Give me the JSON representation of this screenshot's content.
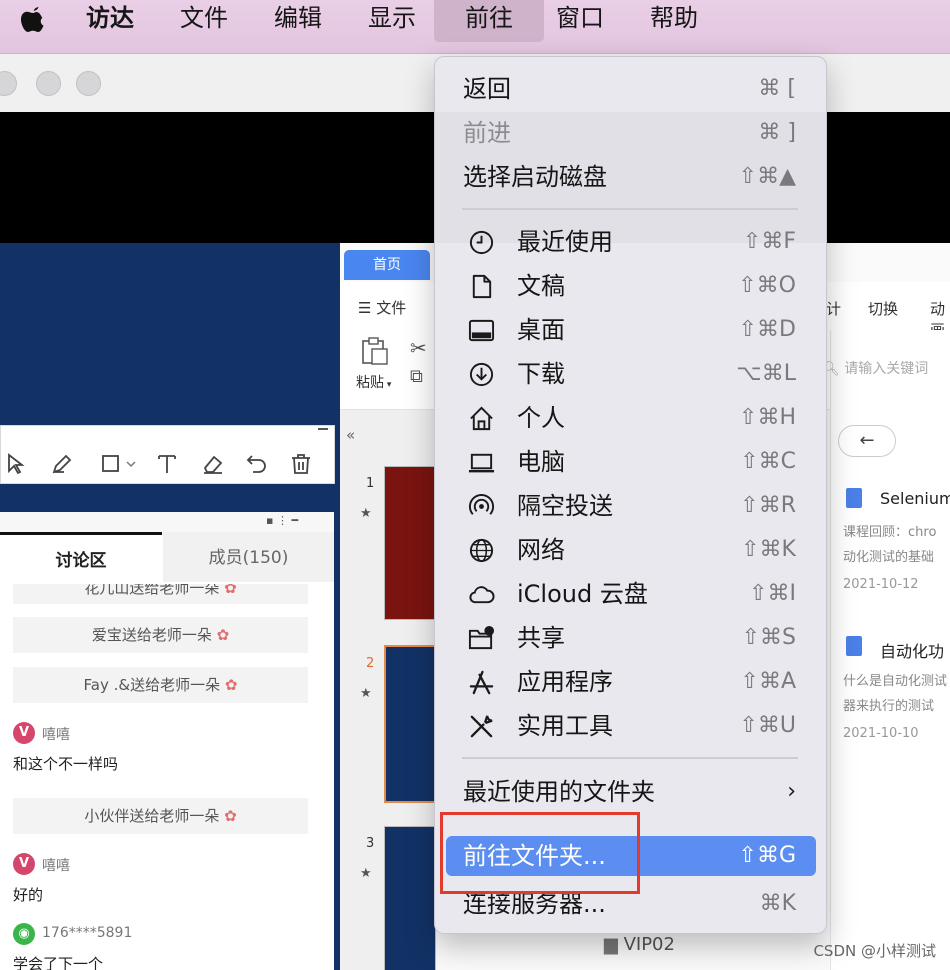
{
  "menubar": {
    "items": [
      "访达",
      "文件",
      "编辑",
      "显示",
      "前往",
      "窗口",
      "帮助"
    ],
    "active_index": 4
  },
  "go_menu": {
    "nav": [
      {
        "label": "返回",
        "shortcut": "⌘ [",
        "disabled": false
      },
      {
        "label": "前进",
        "shortcut": "⌘ ]",
        "disabled": true
      },
      {
        "label": "选择启动磁盘",
        "shortcut": "⇧⌘▲",
        "disabled": false
      }
    ],
    "places": [
      {
        "label": "最近使用",
        "shortcut": "⇧⌘F",
        "icon": "clock-icon"
      },
      {
        "label": "文稿",
        "shortcut": "⇧⌘O",
        "icon": "document-icon"
      },
      {
        "label": "桌面",
        "shortcut": "⇧⌘D",
        "icon": "desktop-icon"
      },
      {
        "label": "下载",
        "shortcut": "⌥⌘L",
        "icon": "download-icon"
      },
      {
        "label": "个人",
        "shortcut": "⇧⌘H",
        "icon": "home-icon"
      },
      {
        "label": "电脑",
        "shortcut": "⇧⌘C",
        "icon": "laptop-icon"
      },
      {
        "label": "隔空投送",
        "shortcut": "⇧⌘R",
        "icon": "airdrop-icon"
      },
      {
        "label": "网络",
        "shortcut": "⇧⌘K",
        "icon": "globe-icon"
      },
      {
        "label": "iCloud 云盘",
        "shortcut": "⇧⌘I",
        "icon": "cloud-icon"
      },
      {
        "label": "共享",
        "shortcut": "⇧⌘S",
        "icon": "shared-folder-icon"
      },
      {
        "label": "应用程序",
        "shortcut": "⇧⌘A",
        "icon": "applications-icon"
      },
      {
        "label": "实用工具",
        "shortcut": "⇧⌘U",
        "icon": "utilities-icon"
      }
    ],
    "recent_folders": "最近使用的文件夹",
    "goto_folder": {
      "label": "前往文件夹...",
      "shortcut": "⇧⌘G"
    },
    "connect_server": {
      "label": "连接服务器...",
      "shortcut": "⌘K"
    }
  },
  "chat": {
    "tabs": [
      "讨论区",
      "成员(150)"
    ],
    "gifts": [
      "花儿山送给老师一朵",
      "爱宝送给老师一朵",
      "Fay .&送给老师一朵",
      "小伙伴送给老师一朵"
    ],
    "messages": [
      {
        "user": "嘻嘻",
        "text": "和这个不一样吗"
      },
      {
        "user": "嘻嘻",
        "text": "好的"
      },
      {
        "user": "176****5891",
        "text": "学会了下一个"
      }
    ],
    "avatar_letter": "V"
  },
  "wps": {
    "tab": "首页",
    "file_menu": "文件",
    "paste": "粘贴",
    "ribbon_right": [
      "计",
      "切换",
      "动画"
    ],
    "search_placeholder": "请输入关键词",
    "slide_numbers": [
      "1",
      "2",
      "3"
    ],
    "docs": [
      {
        "title": "Selenium",
        "sub1": "课程回顾：chro",
        "sub2": "动化测试的基础",
        "date": "2021-10-12"
      },
      {
        "title": "自动化功",
        "sub1": "什么是自动化测试",
        "sub2": "器来执行的测试",
        "date": "2021-10-10"
      }
    ],
    "folder": "VIP02"
  },
  "watermark": "CSDN @小样测试"
}
